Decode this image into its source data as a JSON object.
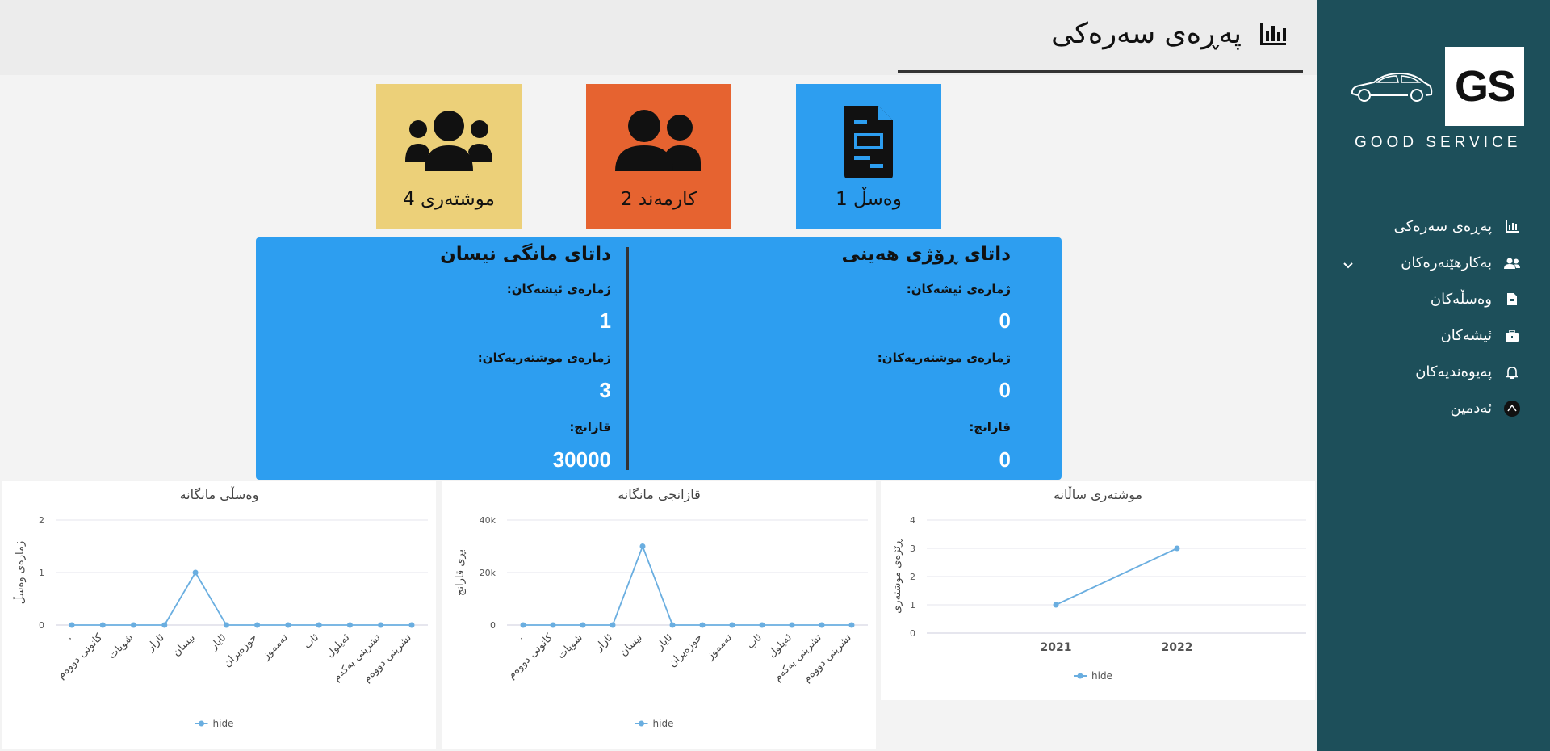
{
  "header": {
    "title": "پەڕەی سەرەکی"
  },
  "brand": {
    "logo_text": "GS",
    "name": "GOOD SERVICE"
  },
  "sidebar": {
    "items": [
      {
        "label": "پەڕەی سەرەکی",
        "icon": "bar-chart-icon"
      },
      {
        "label": "بەکارهێنەرەکان",
        "icon": "users-icon",
        "has_dropdown": true
      },
      {
        "label": "وەسڵەکان",
        "icon": "document-icon"
      },
      {
        "label": "ئیشەکان",
        "icon": "briefcase-icon"
      },
      {
        "label": "پەیوەندیەکان",
        "icon": "bell-icon"
      },
      {
        "label": "ئەدمین",
        "icon": "admin-avatar-icon"
      }
    ]
  },
  "cards": {
    "invoice": {
      "label": "وەسڵ 1",
      "color": "#2d9ef0",
      "icon": "invoice-document-icon"
    },
    "staff": {
      "label": "کارمەند 2",
      "color": "#e66330",
      "icon": "staff-users-icon"
    },
    "customers": {
      "label": "موشتەری 4",
      "color": "#ecd079",
      "icon": "customers-group-icon"
    }
  },
  "info": {
    "day": {
      "title": "داتای ڕۆژی هەینی",
      "jobs_label": "ژمارەی ئیشەکان:",
      "jobs_value": "0",
      "customers_label": "ژمارەی موشتەریەکان:",
      "customers_value": "0",
      "profit_label": "قازانج:",
      "profit_value": "0"
    },
    "month": {
      "title": "داتای مانگی نیسان",
      "jobs_label": "ژمارەی ئیشەکان:",
      "jobs_value": "1",
      "customers_label": "ژمارەی موشتەریەکان:",
      "customers_value": "3",
      "profit_label": "قازانج:",
      "profit_value": "30000"
    }
  },
  "chart_data": [
    {
      "id": "invoices",
      "type": "line",
      "title": "وەسڵی مانگانە",
      "ylabel": "ژمارەی وەسڵ",
      "xlabel": "",
      "categories": [
        ".",
        "کانونی دووەم",
        "شوبات",
        "ئازار",
        "نیسان",
        "ئایار",
        "حوزەیران",
        "تەمموز",
        "ئاب",
        "ئەیلول",
        "تشرینی یەکەم",
        "تشرینی دووەم"
      ],
      "series": [
        {
          "name": "hide",
          "values": [
            0,
            0,
            0,
            0,
            1,
            0,
            0,
            0,
            0,
            0,
            0,
            0
          ]
        }
      ],
      "yticks": [
        "0",
        "1",
        "2"
      ],
      "ylim": [
        0,
        2
      ],
      "legend": "bottom",
      "color": "#6aaee0"
    },
    {
      "id": "profit",
      "type": "line",
      "title": "قازانجی مانگانە",
      "ylabel": "بڕی قازانج",
      "xlabel": "",
      "categories": [
        ".",
        "کانونی دووەم",
        "شوبات",
        "ئازار",
        "نیسان",
        "ئایار",
        "حوزەیران",
        "تەمموز",
        "ئاب",
        "ئەیلول",
        "تشرینی یەکەم",
        "تشرینی دووەم"
      ],
      "series": [
        {
          "name": "hide",
          "values": [
            0,
            0,
            0,
            0,
            30000,
            0,
            0,
            0,
            0,
            0,
            0,
            0
          ]
        }
      ],
      "yticks": [
        "0",
        "20k",
        "40k"
      ],
      "ylim": [
        0,
        40000
      ],
      "legend": "bottom",
      "color": "#6aaee0"
    },
    {
      "id": "customers",
      "type": "line",
      "title": "موشتەری ساڵانە",
      "ylabel": "ڕێژەی موشتەری",
      "xlabel": "",
      "categories": [
        "2021",
        "2022"
      ],
      "series": [
        {
          "name": "hide",
          "values": [
            1,
            3
          ]
        }
      ],
      "yticks": [
        "0",
        "1",
        "2",
        "3",
        "4"
      ],
      "ylim": [
        0,
        4
      ],
      "legend": "bottom",
      "color": "#6aaee0"
    }
  ]
}
